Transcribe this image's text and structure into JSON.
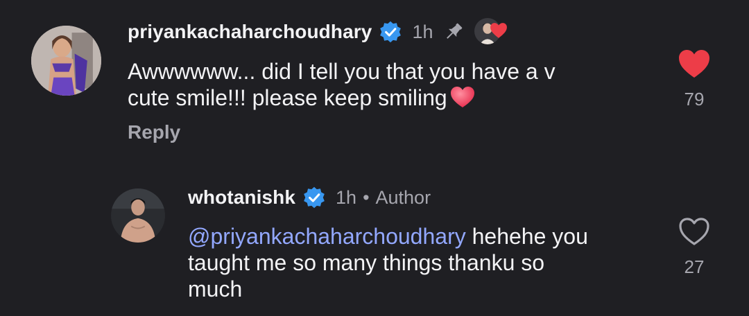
{
  "comment": {
    "username": "priyankachaharchoudhary",
    "time": "1h",
    "text_line1": "Awwwwww... did I tell you that you have a v",
    "text_line2": "cute smile!!! please keep smiling",
    "reply_label": "Reply",
    "likes": "79",
    "liked": true
  },
  "reply": {
    "username": "whotanishk",
    "time": "1h",
    "separator": "•",
    "badge": "Author",
    "mention": "@priyankachaharchoudhary",
    "text_rest_line1": " hehehe you",
    "text_line2": "taught me so many things thanku so",
    "text_line3": "much",
    "likes": "27",
    "liked": false
  },
  "colors": {
    "background": "#1f1f23",
    "text": "#f3f3f5",
    "muted": "#a6a6ae",
    "mention": "#93a8ff",
    "verified": "#3897f0",
    "like_red": "#ed3d48"
  },
  "icons": [
    "verified-badge-icon",
    "pin-icon",
    "heart-filled-icon",
    "heart-outline-icon",
    "heart-emoji-icon"
  ]
}
